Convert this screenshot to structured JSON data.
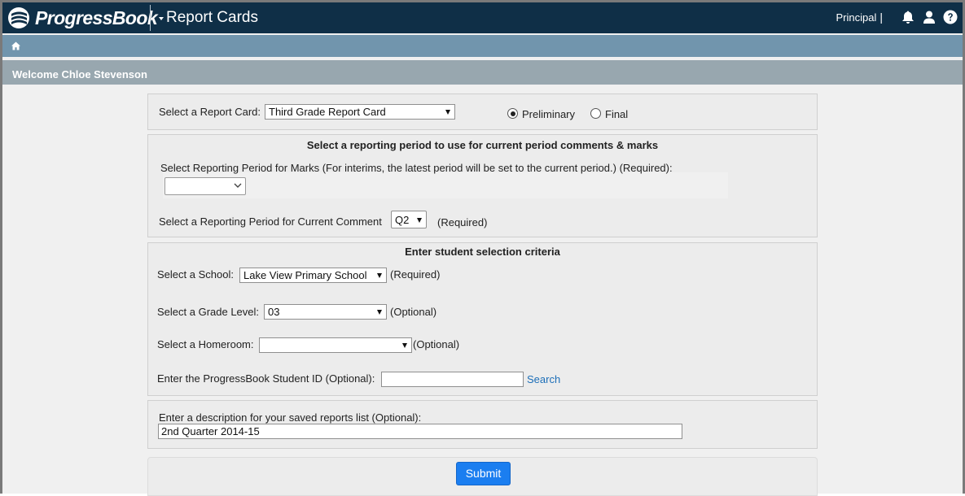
{
  "header": {
    "logo_text": "ProgressBook",
    "app_title": "Report Cards",
    "role": "Principal",
    "role_separator": "|",
    "icons": [
      "bell-icon",
      "user-icon",
      "help-icon"
    ]
  },
  "nav": {
    "home_icon": "home-icon"
  },
  "welcome": "Welcome Chloe Stevenson",
  "report_card": {
    "label": "Select a Report Card:",
    "value": "Third Grade Report Card",
    "options": [
      {
        "label": "Preliminary",
        "selected": true
      },
      {
        "label": "Final",
        "selected": false
      }
    ]
  },
  "period": {
    "heading": "Select a reporting period to use for current period comments & marks",
    "marks_label": "Select Reporting Period for Marks (For interims, the latest period will be set to the current period.) (Required):",
    "marks_value": "",
    "comment_label": "Select a Reporting Period for Current Comment",
    "comment_value": "Q2",
    "comment_required": "(Required)"
  },
  "criteria": {
    "heading": "Enter student selection criteria",
    "school_label": "Select a School:",
    "school_value": "Lake View Primary School",
    "school_note": "(Required)",
    "grade_label": "Select a Grade Level:",
    "grade_value": "03",
    "grade_note": "(Optional)",
    "homeroom_label": "Select a Homeroom:",
    "homeroom_value": "",
    "homeroom_note": "(Optional)",
    "student_id_label": "Enter the ProgressBook Student ID (Optional):",
    "student_id_value": "",
    "search_link": "Search"
  },
  "description": {
    "label": "Enter a description for your saved reports list (Optional):",
    "value": "2nd Quarter 2014-15"
  },
  "submit_label": "Submit",
  "colors": {
    "header_bg": "#0f2f47",
    "nav_bg": "#7195ad",
    "welcome_bg": "#98a7af",
    "button_bg": "#1b7ef0",
    "link": "#1d6fb8"
  }
}
